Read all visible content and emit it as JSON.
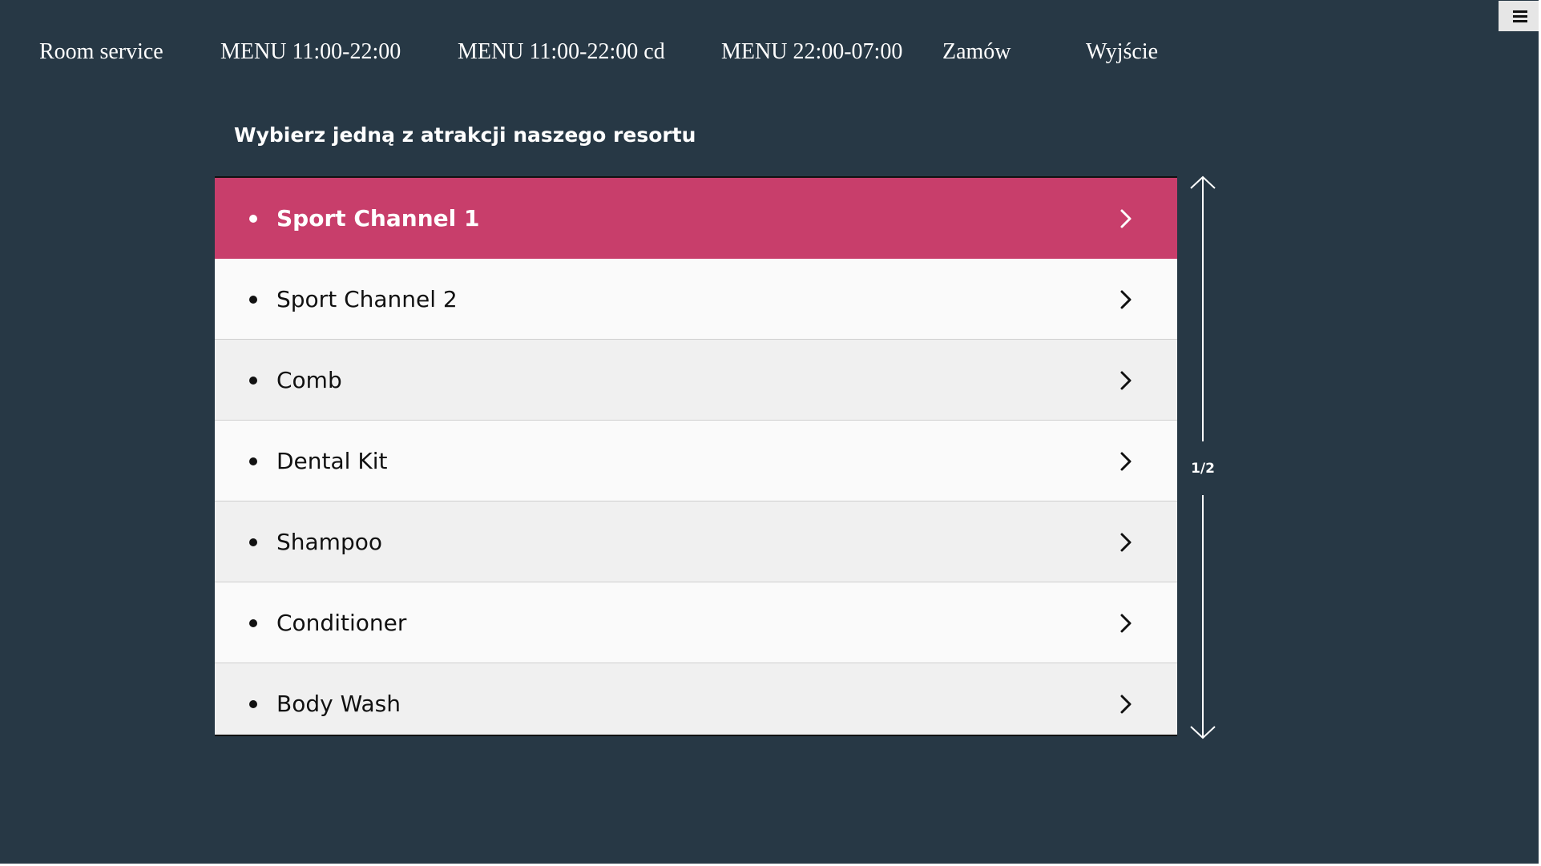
{
  "nav": {
    "items": [
      {
        "label": "Room service"
      },
      {
        "label": "MENU 11:00-22:00"
      },
      {
        "label": "MENU 11:00-22:00 cd"
      },
      {
        "label": "MENU 22:00-07:00"
      },
      {
        "label": "Zamów"
      },
      {
        "label": "Wyjście"
      }
    ],
    "menu_icon": "hamburger-icon"
  },
  "main": {
    "heading": "Wybierz jedną z atrakcji naszego resortu",
    "selected_index": 0,
    "items": [
      {
        "label": "Sport Channel 1",
        "icon": "chevron-right-icon"
      },
      {
        "label": "Sport Channel 2",
        "icon": "chevron-right-icon"
      },
      {
        "label": "Comb",
        "icon": "chevron-right-icon"
      },
      {
        "label": "Dental Kit",
        "icon": "chevron-right-icon"
      },
      {
        "label": "Shampoo",
        "icon": "chevron-right-icon"
      },
      {
        "label": "Conditioner",
        "icon": "chevron-right-icon"
      },
      {
        "label": "Body Wash",
        "icon": "chevron-right-icon"
      }
    ]
  },
  "pager": {
    "page_text": "1/2",
    "up_icon": "arrow-up-icon",
    "down_icon": "arrow-down-icon"
  },
  "colors": {
    "background": "#273845",
    "accent": "#c83e6b",
    "row_light": "#fafafa",
    "row_alt": "#f0f0f0",
    "text_light": "#ffffff",
    "text_dark": "#111111"
  }
}
